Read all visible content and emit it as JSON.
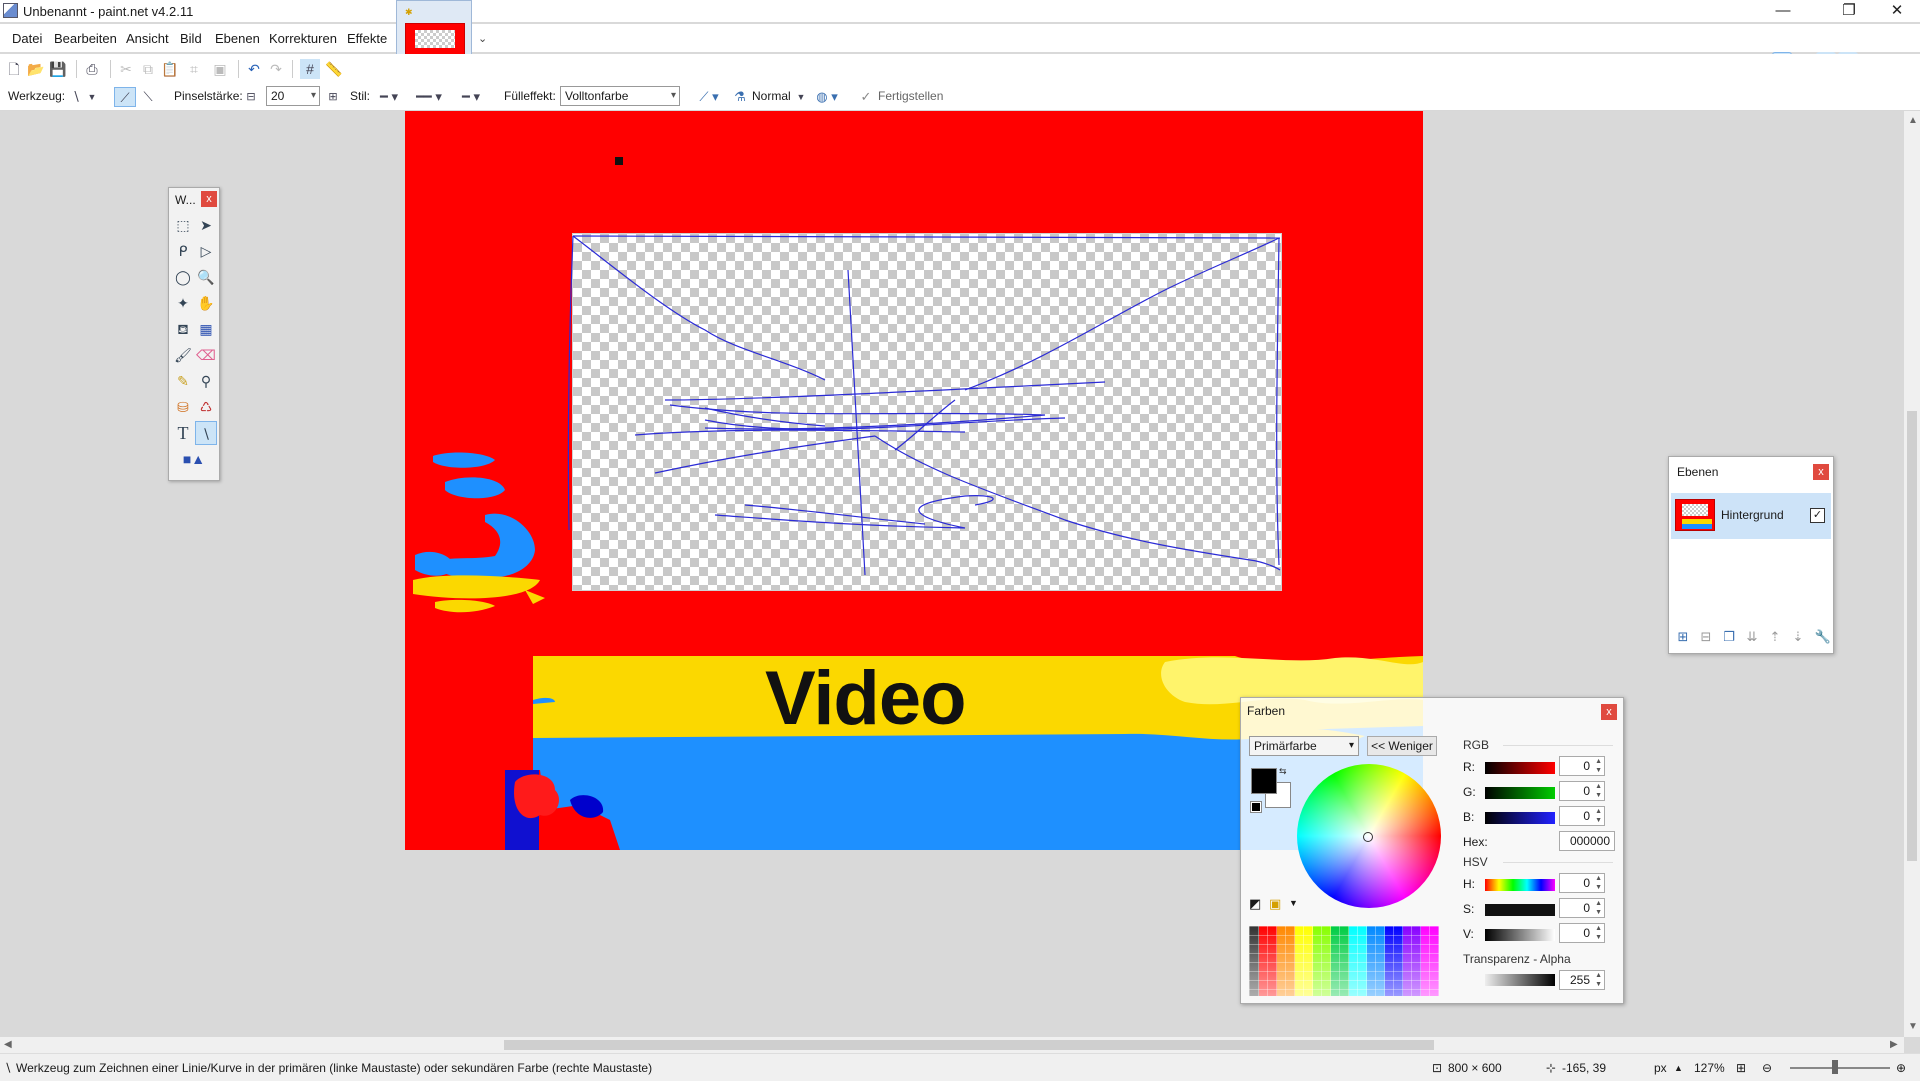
{
  "window": {
    "title": "Unbenannt - paint.net v4.2.11",
    "minimize": "—",
    "restore": "❐",
    "close": "✕"
  },
  "menu": {
    "items": [
      "Datei",
      "Bearbeiten",
      "Ansicht",
      "Bild",
      "Ebenen",
      "Korrekturen",
      "Effekte"
    ]
  },
  "toolbar": {
    "tool_label": "Werkzeug:",
    "brush_width_label": "Pinselstärke:",
    "brush_width_value": "20",
    "style_label": "Stil:",
    "fill_label": "Fülleffekt:",
    "fill_value": "Volltonfarbe",
    "blend_mode": "Normal",
    "finish_label": "Fertigstellen"
  },
  "canvas": {
    "text": "Video",
    "colors": {
      "background": "#ff0000",
      "yellow": "#fbd800",
      "blue": "#1e90ff",
      "stroke": "#2b2bd6"
    }
  },
  "tools_window": {
    "title": "W...",
    "close": "x"
  },
  "layers_window": {
    "title": "Ebenen",
    "close": "x",
    "layers": [
      {
        "name": "Hintergrund",
        "visible_mark": "✓"
      }
    ]
  },
  "colors_window": {
    "title": "Farben",
    "close": "x",
    "target": "Primärfarbe",
    "less_button": "<< Weniger",
    "rgb_heading": "RGB",
    "r_label": "R:",
    "r_value": "0",
    "g_label": "G:",
    "g_value": "0",
    "b_label": "B:",
    "b_value": "0",
    "hex_label": "Hex:",
    "hex_value": "000000",
    "hsv_heading": "HSV",
    "h_label": "H:",
    "h_value": "0",
    "s_label": "S:",
    "s_value": "0",
    "v_label": "V:",
    "v_value": "0",
    "alpha_heading": "Transparenz - Alpha",
    "alpha_value": "255",
    "primary_color": "#000000",
    "secondary_color": "#ffffff"
  },
  "statusbar": {
    "hint": "Werkzeug zum Zeichnen einer Linie/Kurve in der primären (linke Maustaste) oder sekundären Farbe (rechte Maustaste)",
    "image_size": "800 × 600",
    "cursor_pos": "-165, 39",
    "unit": "px",
    "zoom": "127%"
  }
}
